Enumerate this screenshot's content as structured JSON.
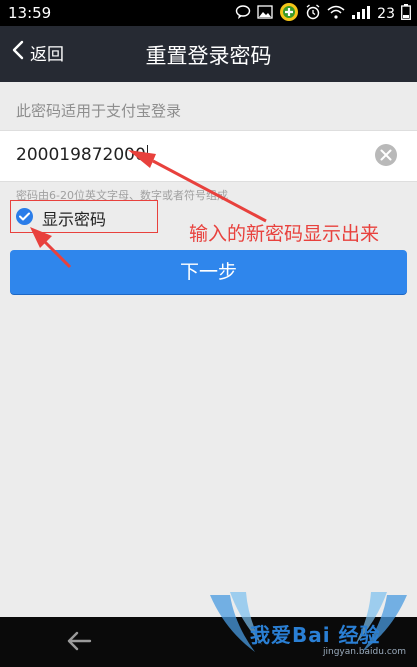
{
  "status_bar": {
    "time": "13:59",
    "battery": "23",
    "icons": [
      "chat-icon",
      "picture-icon",
      "app-badge-icon",
      "alarm-icon",
      "wifi-icon",
      "signal-icon",
      "battery-icon"
    ]
  },
  "header": {
    "back_label": "返回",
    "title": "重置登录密码"
  },
  "form": {
    "hint": "此密码适用于支付宝登录",
    "password_value": "200019872000",
    "rule_hint": "密码由6-20位英文字母、数字或者符号组成",
    "show_password_label": "显示密码",
    "show_password_checked": true,
    "next_label": "下一步"
  },
  "annotation": {
    "text": "输入的新密码显示出来",
    "color": "#e8413d"
  },
  "watermark": {
    "brand": "我爱Bai 经验",
    "url": "jingyan.baidu.com"
  },
  "colors": {
    "title_bar": "#262a33",
    "primary_button": "#2f86ec",
    "background": "#ececec"
  }
}
